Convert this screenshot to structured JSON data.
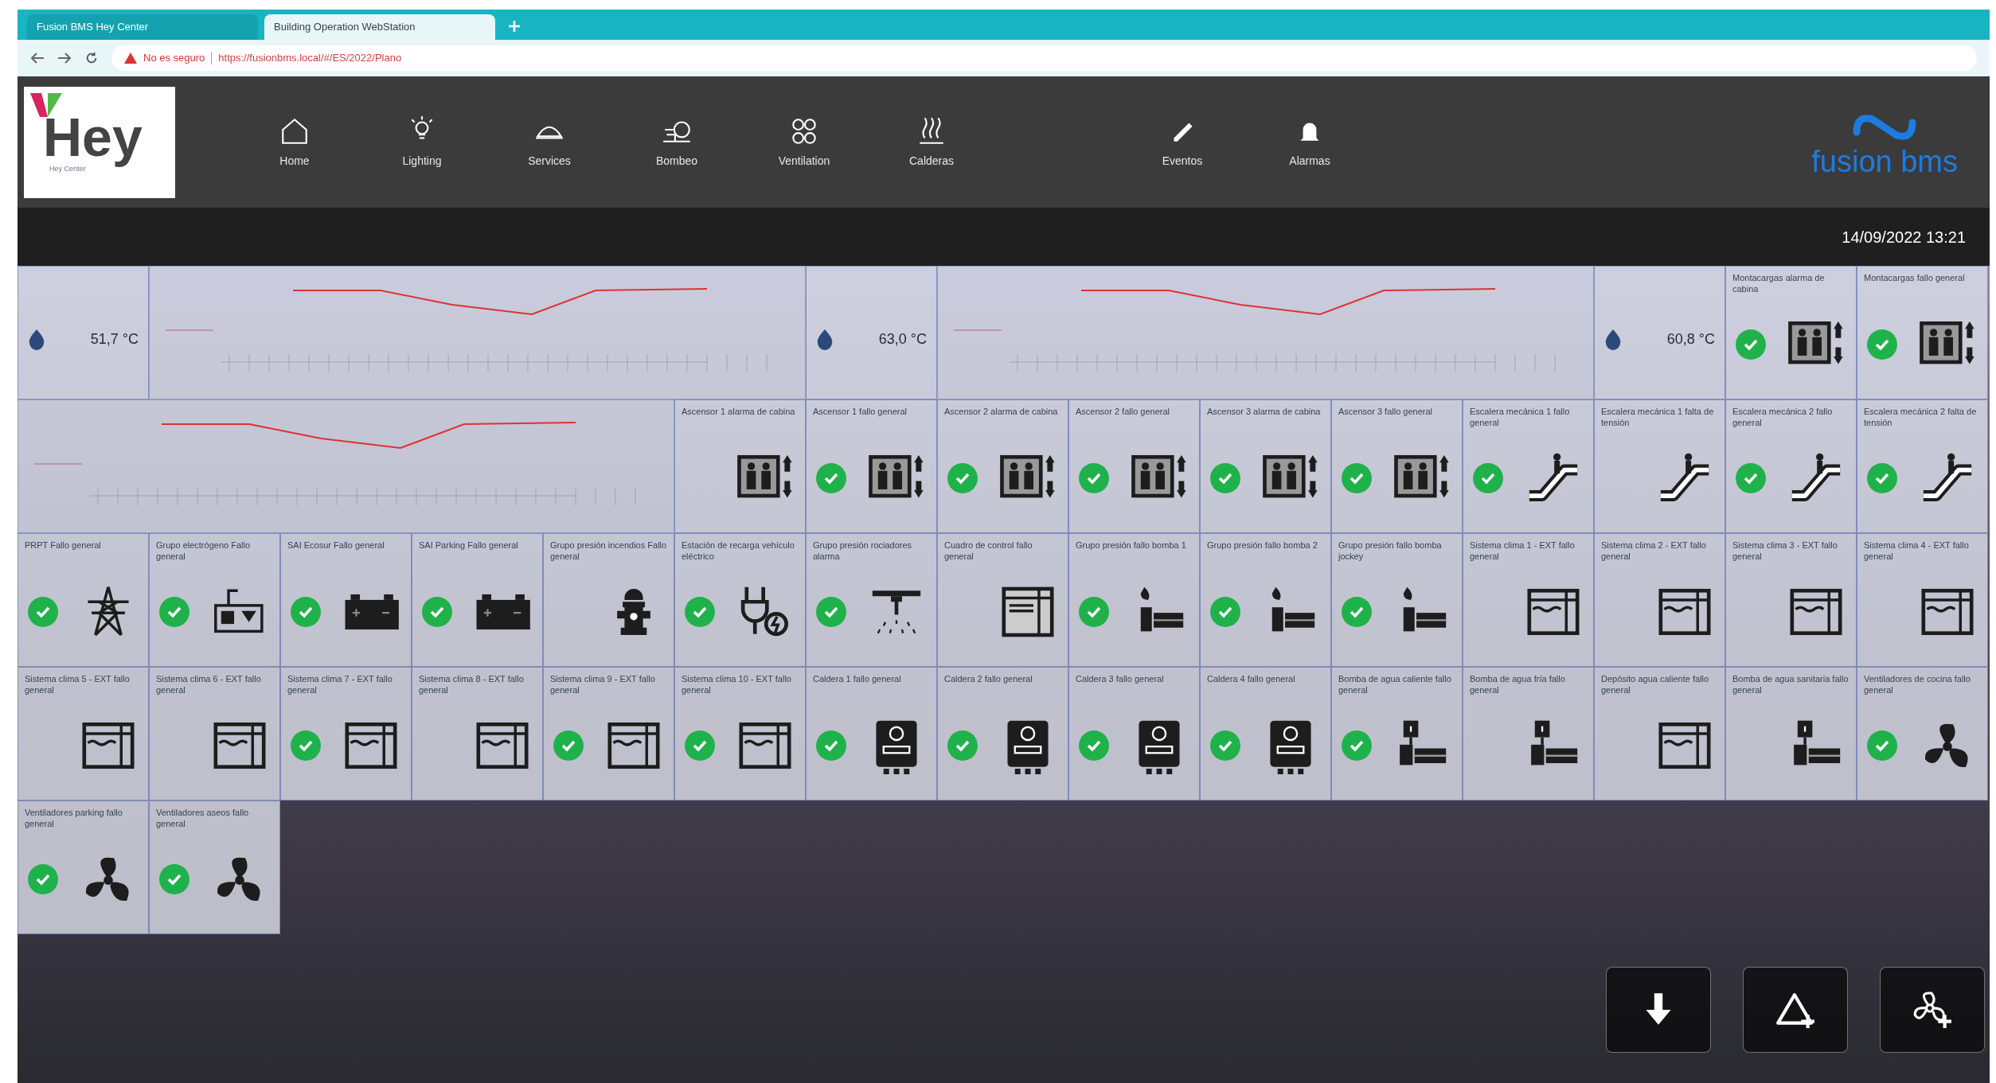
{
  "browser": {
    "tabs": [
      {
        "label": "Fusion BMS Hey Center",
        "selected": false
      },
      {
        "label": "Building Operation WebStation",
        "selected": true
      }
    ],
    "address": {
      "warning": "No es seguro",
      "url": "https://fusionbms.local/#/ES/2022/Plano"
    }
  },
  "header": {
    "logo": {
      "word": "Hey",
      "caption": "Hey Center"
    },
    "nav": [
      {
        "label": "Home",
        "kind": "home"
      },
      {
        "label": "Lighting",
        "kind": "bulb"
      },
      {
        "label": "Services",
        "kind": "dome"
      },
      {
        "label": "Bombeo",
        "kind": "pump"
      },
      {
        "label": "Ventilation",
        "kind": "fan"
      },
      {
        "label": "Calderas",
        "kind": "heat"
      },
      {
        "label": "Eventos",
        "kind": "pencil"
      },
      {
        "label": "Alarmas",
        "kind": "bell"
      }
    ],
    "brand": "fusion bms",
    "datetime": "14/09/2022 13:21"
  },
  "tiles": [
    {
      "kind": "temperature",
      "reading": "51,7 °C"
    },
    {
      "kind": "chart"
    },
    {
      "kind": "temperature",
      "reading": "63,0 °C"
    },
    {
      "kind": "chart"
    },
    {
      "kind": "temperature",
      "reading": "60,8 °C"
    },
    {
      "kind": "elevator",
      "title": "Montacargas alarma de cabina",
      "ok": true
    },
    {
      "kind": "elevator",
      "title": "Montacargas fallo general",
      "ok": true
    },
    {
      "kind": "chart"
    },
    {
      "kind": "elevator",
      "title": "Ascensor 1 alarma de cabina",
      "ok": false
    },
    {
      "kind": "elevator",
      "title": "Ascensor 1 fallo general",
      "ok": true
    },
    {
      "kind": "elevator",
      "title": "Ascensor 2 alarma de cabina",
      "ok": true
    },
    {
      "kind": "elevator",
      "title": "Ascensor 2 fallo general",
      "ok": true
    },
    {
      "kind": "elevator",
      "title": "Ascensor 3 alarma de cabina",
      "ok": true
    },
    {
      "kind": "elevator",
      "title": "Ascensor 3 fallo general",
      "ok": true
    },
    {
      "kind": "escalator",
      "title": "Escalera mecánica 1 fallo general",
      "ok": true
    },
    {
      "kind": "escalator",
      "title": "Escalera mecánica 1 falta de tensión",
      "ok": false
    },
    {
      "kind": "escalator",
      "title": "Escalera mecánica 2 fallo general",
      "ok": true
    },
    {
      "kind": "escalator",
      "title": "Escalera mecánica 2 falta de tensión",
      "ok": true
    },
    {
      "kind": "pylon",
      "title": "PRPT Fallo general",
      "ok": true
    },
    {
      "kind": "generator",
      "title": "Grupo electrógeno Fallo general",
      "ok": true
    },
    {
      "kind": "battery",
      "title": "SAI Ecosur Fallo general",
      "ok": true
    },
    {
      "kind": "battery",
      "title": "SAI Parking Fallo general",
      "ok": true
    },
    {
      "kind": "hydrant",
      "title": "Grupo presión incendios Fallo general",
      "ok": false
    },
    {
      "kind": "charger",
      "title": "Estación de recarga vehículo eléctrico",
      "ok": true
    },
    {
      "kind": "sprinkler",
      "title": "Grupo presión rociadores alarma",
      "ok": true
    },
    {
      "kind": "cabinet",
      "title": "Cuadro de control fallo general",
      "ok": false
    },
    {
      "kind": "firepump",
      "title": "Grupo presión fallo bomba 1",
      "ok": true
    },
    {
      "kind": "firepump",
      "title": "Grupo presión fallo bomba 2",
      "ok": true
    },
    {
      "kind": "firepump",
      "title": "Grupo presión fallo bomba jockey",
      "ok": true
    },
    {
      "kind": "tank",
      "title": "Sistema clima 1 - EXT fallo general",
      "ok": false
    },
    {
      "kind": "tank",
      "title": "Sistema clima 2 - EXT fallo general",
      "ok": false
    },
    {
      "kind": "tank",
      "title": "Sistema clima 3 - EXT fallo general",
      "ok": false
    },
    {
      "kind": "tank",
      "title": "Sistema clima 4 - EXT fallo general",
      "ok": false
    },
    {
      "kind": "tank",
      "title": "Sistema clima 5 - EXT fallo general",
      "ok": false
    },
    {
      "kind": "tank",
      "title": "Sistema clima 6 - EXT fallo general",
      "ok": false
    },
    {
      "kind": "tank",
      "title": "Sistema clima 7 - EXT fallo general",
      "ok": true
    },
    {
      "kind": "tank",
      "title": "Sistema clima 8 - EXT fallo general",
      "ok": false
    },
    {
      "kind": "tank",
      "title": "Sistema clima 9 - EXT fallo general",
      "ok": true
    },
    {
      "kind": "tank",
      "title": "Sistema clima 10 - EXT fallo general",
      "ok": true
    },
    {
      "kind": "boiler",
      "title": "Caldera 1 fallo general",
      "ok": true
    },
    {
      "kind": "boiler",
      "title": "Caldera 2 fallo general",
      "ok": true
    },
    {
      "kind": "boiler",
      "title": "Caldera 3 fallo general",
      "ok": true
    },
    {
      "kind": "boiler",
      "title": "Caldera 4 fallo general",
      "ok": true
    },
    {
      "kind": "pump",
      "title": "Bomba de agua caliente fallo general",
      "ok": true
    },
    {
      "kind": "pump",
      "title": "Bomba de agua fría fallo general",
      "ok": false
    },
    {
      "kind": "tank",
      "title": "Depósito agua caliente fallo general",
      "ok": false
    },
    {
      "kind": "pump",
      "title": "Bomba de agua sanitaria fallo general",
      "ok": false
    },
    {
      "kind": "fan",
      "title": "Ventiladores de cocina fallo general",
      "ok": true
    },
    {
      "kind": "fan",
      "title": "Ventiladores parking fallo general",
      "ok": true
    },
    {
      "kind": "fan",
      "title": "Ventiladores aseos fallo general",
      "ok": true
    }
  ],
  "actions": [
    {
      "kind": "download"
    },
    {
      "kind": "alarm-add"
    },
    {
      "kind": "fan-add"
    }
  ]
}
